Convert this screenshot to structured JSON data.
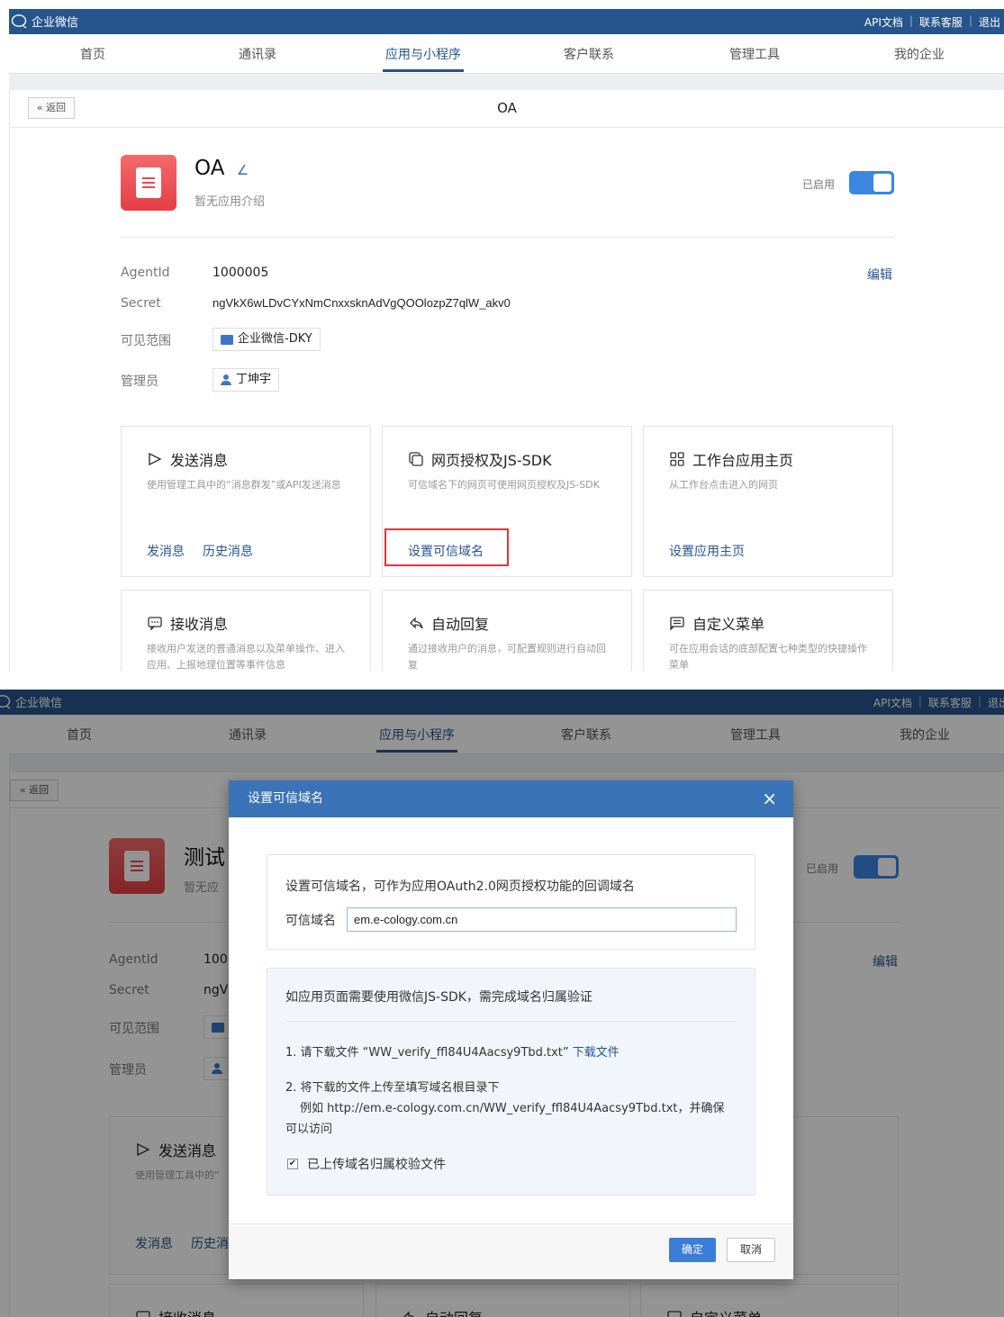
{
  "app": {
    "brand": "企业微信",
    "top_links": [
      "API文档",
      "联系客服",
      "退出"
    ],
    "nav": [
      "首页",
      "通讯录",
      "应用与小程序",
      "客户联系",
      "管理工具",
      "我的企业"
    ],
    "back_label": "« 返回"
  },
  "screen1": {
    "page_title": "OA",
    "app_name": "OA",
    "app_intro": "暂无应用介绍",
    "enabled_label": "已启用",
    "edit_label": "编辑",
    "fields": {
      "agentid_label": "AgentId",
      "agentid_value": "1000005",
      "secret_label": "Secret",
      "secret_value": "ngVkX6wLDvCYxNmCnxxsknAdVgQOOlozpZ7qlW_akv0",
      "visible_label": "可见范围",
      "visible_value": "企业微信-DKY",
      "admin_label": "管理员",
      "admin_value": "丁坤宇"
    },
    "cards": [
      {
        "title": "发送消息",
        "desc": "使用管理工具中的“消息群发”或API发送消息",
        "links": [
          "发消息",
          "历史消息"
        ]
      },
      {
        "title": "网页授权及JS-SDK",
        "desc": "可信域名下的网页可使用网页授权及JS-SDK",
        "links": [
          "设置可信域名"
        ]
      },
      {
        "title": "工作台应用主页",
        "desc": "从工作台点击进入的网页",
        "links": [
          "设置应用主页"
        ]
      },
      {
        "title": "接收消息",
        "desc": "接收用户发送的普通消息以及菜单操作、进入应用、上报地理位置等事件信息",
        "links": []
      },
      {
        "title": "自动回复",
        "desc": "通过接收用户的消息，可配置规则进行自动回复",
        "links": []
      },
      {
        "title": "自定义菜单",
        "desc": "可在应用会话的底部配置七种类型的快捷操作菜单",
        "links": []
      }
    ]
  },
  "screen2": {
    "app_name": "测试",
    "app_intro": "暂无应",
    "enabled_label": "已启用",
    "edit_label": "编辑",
    "agentid_value": "100(",
    "secret_value": "ngV",
    "card_title": "发送消息",
    "card_desc": "使用管理工具中的“",
    "card_links": [
      "发消息",
      "历史消"
    ],
    "card_bottom": [
      "接收消息",
      "自动回复",
      "自定义菜单"
    ],
    "dialog": {
      "title": "设置可信域名",
      "close": "×",
      "intro": "设置可信域名，可作为应用OAuth2.0网页授权功能的回调域名",
      "domain_label": "可信域名",
      "domain_value": "em.e-cology.com.cn",
      "verify_title": "如应用页面需要使用微信JS-SDK，需完成域名归属验证",
      "step1": "1. 请下载文件 “WW_verify_ffl84U4Aacsy9Tbd.txt”",
      "download": "下载文件",
      "step2": "2. 将下载的文件上传至填写域名根目录下",
      "step2_example": "例如 http://em.e-cology.com.cn/WW_verify_ffl84U4Aacsy9Tbd.txt，并确保",
      "step2_tail": "可以访问",
      "checkbox_label": "已上传域名归属校验文件",
      "ok": "确定",
      "cancel": "取消"
    }
  },
  "colors": {
    "header": "#26558d",
    "accent": "#3b86e0",
    "dialog_header": "#3a73b7",
    "highlight": "#e0353c"
  }
}
